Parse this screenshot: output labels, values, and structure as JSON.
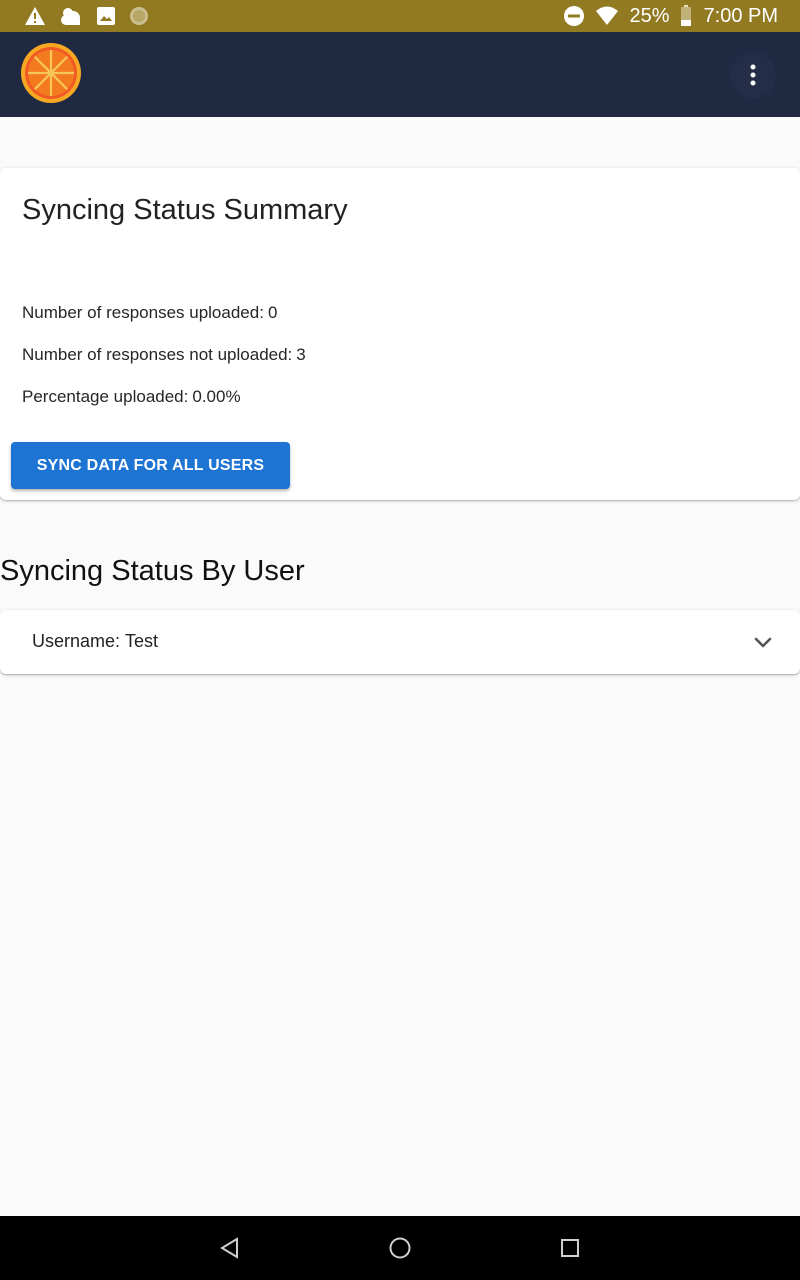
{
  "status_bar": {
    "icons_left": [
      "alert-icon",
      "weather-icon",
      "image-icon",
      "circle-icon"
    ],
    "icons_right": [
      "do-not-disturb-icon",
      "wifi-icon",
      "battery-icon"
    ],
    "battery": "25%",
    "time": "7:00 PM",
    "background": "#917a22"
  },
  "app_bar": {
    "logo": "orange-slice-logo",
    "menu_icon": "more-vert-icon",
    "background": "#1f2942"
  },
  "summary": {
    "title": "Syncing Status Summary",
    "uploaded_label": "Number of responses uploaded:",
    "uploaded_value": "0",
    "not_uploaded_label": "Number of responses not uploaded:",
    "not_uploaded_value": "3",
    "percentage_label": "Percentage uploaded:",
    "percentage_value": "0.00%",
    "sync_button_label": "SYNC DATA FOR ALL USERS",
    "accent": "#1e74d2"
  },
  "by_user": {
    "title": "Syncing Status By User",
    "users": [
      {
        "label": "Username:",
        "value": "Test"
      }
    ]
  },
  "nav_bar": {
    "icons": [
      "back-icon",
      "home-icon",
      "recents-icon"
    ]
  }
}
